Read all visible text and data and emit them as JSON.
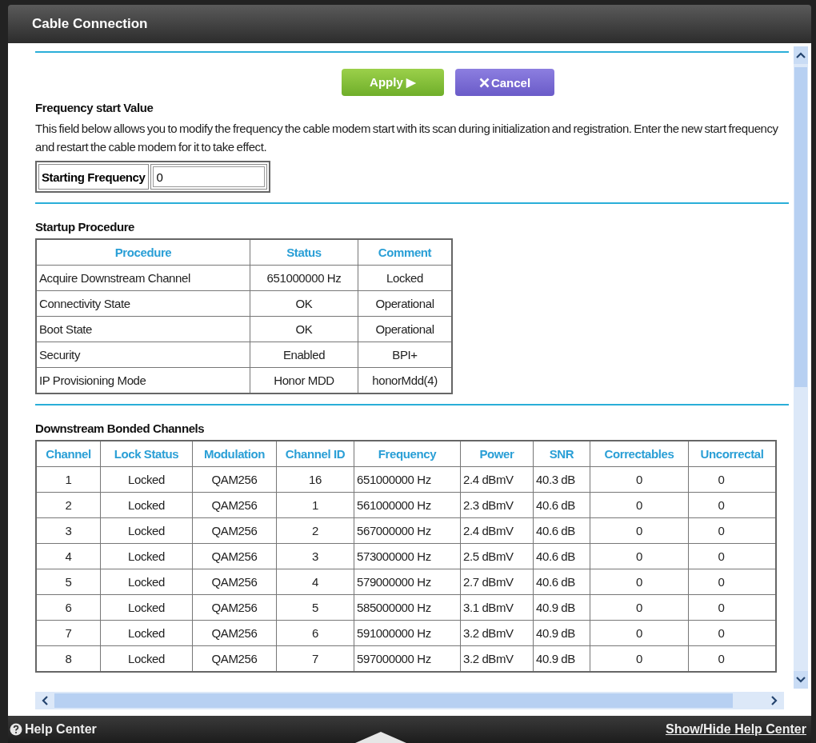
{
  "window": {
    "title": "Cable Connection"
  },
  "buttons": [
    {
      "kind": "apply",
      "label": "Apply ▶"
    },
    {
      "kind": "cancel",
      "label": "Cancel"
    }
  ],
  "frequency": {
    "heading": "Frequency start Value",
    "description": "This field below allows you to modify the frequency the cable modem start with its scan during initialization and registration. Enter the new start frequency and restart the cable modem for it to take effect.",
    "label": "Starting Frequency",
    "value": "0"
  },
  "startup": {
    "heading": "Startup Procedure",
    "columns": [
      "Procedure",
      "Status",
      "Comment"
    ],
    "rows": [
      [
        "Acquire Downstream Channel",
        "651000000 Hz",
        "Locked"
      ],
      [
        "Connectivity State",
        "OK",
        "Operational"
      ],
      [
        "Boot State",
        "OK",
        "Operational"
      ],
      [
        "Security",
        "Enabled",
        "BPI+"
      ],
      [
        "IP Provisioning Mode",
        "Honor MDD",
        "honorMdd(4)"
      ]
    ]
  },
  "downstream": {
    "heading": "Downstream Bonded Channels",
    "columns": [
      "Channel",
      "Lock Status",
      "Modulation",
      "Channel ID",
      "Frequency",
      "Power",
      "SNR",
      "Correctables",
      "Uncorrectal"
    ],
    "rows": [
      [
        "1",
        "Locked",
        "QAM256",
        "16",
        "651000000 Hz",
        "2.4 dBmV",
        "40.3 dB",
        "0",
        "0"
      ],
      [
        "2",
        "Locked",
        "QAM256",
        "1",
        "561000000 Hz",
        "2.3 dBmV",
        "40.6 dB",
        "0",
        "0"
      ],
      [
        "3",
        "Locked",
        "QAM256",
        "2",
        "567000000 Hz",
        "2.4 dBmV",
        "40.6 dB",
        "0",
        "0"
      ],
      [
        "4",
        "Locked",
        "QAM256",
        "3",
        "573000000 Hz",
        "2.5 dBmV",
        "40.6 dB",
        "0",
        "0"
      ],
      [
        "5",
        "Locked",
        "QAM256",
        "4",
        "579000000 Hz",
        "2.7 dBmV",
        "40.6 dB",
        "0",
        "0"
      ],
      [
        "6",
        "Locked",
        "QAM256",
        "5",
        "585000000 Hz",
        "3.1 dBmV",
        "40.9 dB",
        "0",
        "0"
      ],
      [
        "7",
        "Locked",
        "QAM256",
        "6",
        "591000000 Hz",
        "3.2 dBmV",
        "40.9 dB",
        "0",
        "0"
      ],
      [
        "8",
        "Locked",
        "QAM256",
        "7",
        "597000000 Hz",
        "3.2 dBmV",
        "40.9 dB",
        "0",
        "0"
      ]
    ]
  },
  "footer": {
    "help": "Help Center",
    "toggle": "Show/Hide Help Center"
  }
}
